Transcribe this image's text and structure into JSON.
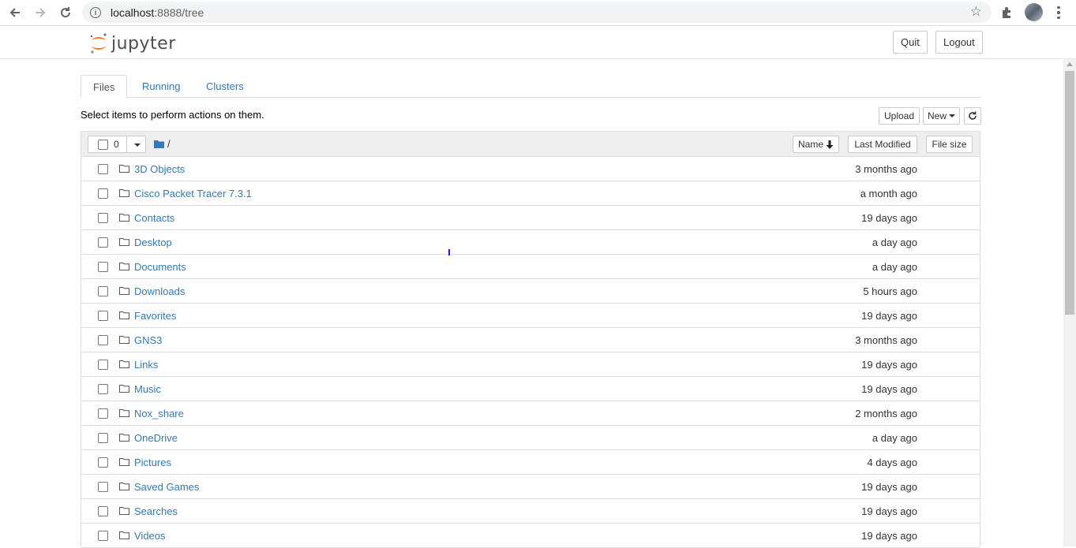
{
  "browser": {
    "url_host": "localhost",
    "url_path": ":8888/tree"
  },
  "header": {
    "logo_text": "jupyter",
    "quit_label": "Quit",
    "logout_label": "Logout"
  },
  "tabs": [
    {
      "label": "Files",
      "active": true
    },
    {
      "label": "Running",
      "active": false
    },
    {
      "label": "Clusters",
      "active": false
    }
  ],
  "toolbar": {
    "select_message": "Select items to perform actions on them.",
    "upload_label": "Upload",
    "new_label": "New"
  },
  "list_header": {
    "selected_count": "0",
    "breadcrumb": "/",
    "sort_name_label": "Name",
    "last_modified_label": "Last Modified",
    "file_size_label": "File size"
  },
  "files": [
    {
      "name": "3D Objects",
      "modified": "3 months ago"
    },
    {
      "name": "Cisco Packet Tracer 7.3.1",
      "modified": "a month ago"
    },
    {
      "name": "Contacts",
      "modified": "19 days ago"
    },
    {
      "name": "Desktop",
      "modified": "a day ago"
    },
    {
      "name": "Documents",
      "modified": "a day ago"
    },
    {
      "name": "Downloads",
      "modified": "5 hours ago"
    },
    {
      "name": "Favorites",
      "modified": "19 days ago"
    },
    {
      "name": "GNS3",
      "modified": "3 months ago"
    },
    {
      "name": "Links",
      "modified": "19 days ago"
    },
    {
      "name": "Music",
      "modified": "19 days ago"
    },
    {
      "name": "Nox_share",
      "modified": "2 months ago"
    },
    {
      "name": "OneDrive",
      "modified": "a day ago"
    },
    {
      "name": "Pictures",
      "modified": "4 days ago"
    },
    {
      "name": "Saved Games",
      "modified": "19 days ago"
    },
    {
      "name": "Searches",
      "modified": "19 days ago"
    },
    {
      "name": "Videos",
      "modified": "19 days ago"
    }
  ]
}
